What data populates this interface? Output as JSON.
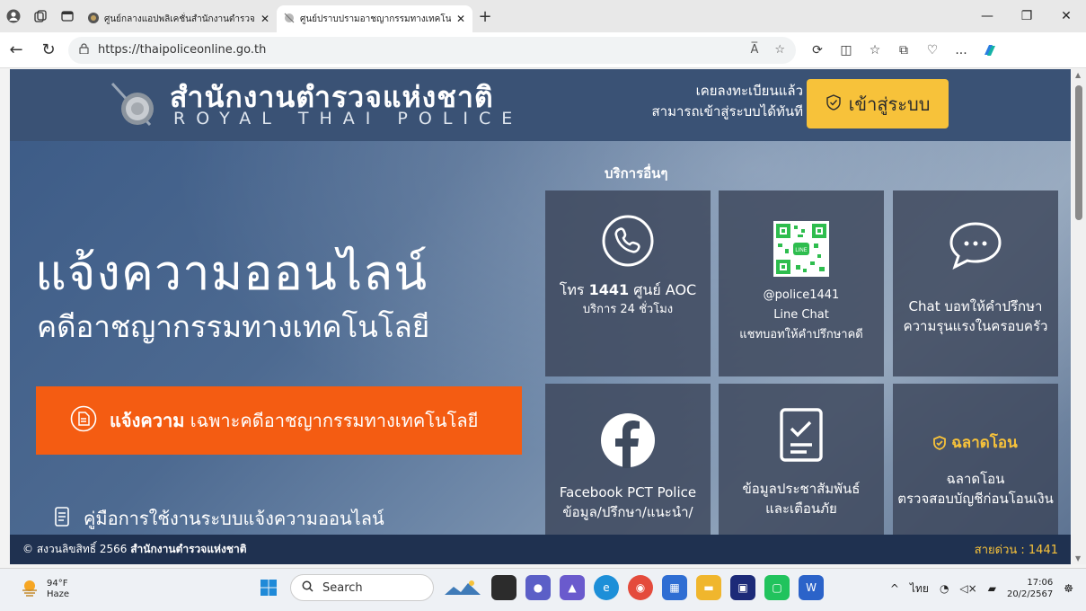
{
  "browser": {
    "tabs": [
      {
        "title": "ศูนย์กลางแอปพลิเคชั่นสำนักงานตำรวจ",
        "active": false
      },
      {
        "title": "ศูนย์ปราบปรามอาชญากรรมทางเทคโนโ",
        "active": true
      }
    ],
    "url": "https://thaipoliceonline.go.th",
    "reader_icon": "A̅",
    "more_label": "..."
  },
  "header": {
    "title_th": "สำนักงานตำรวจแห่งชาติ",
    "title_en": "ROYAL THAI POLICE",
    "registered_line1": "เคยลงทะเบียนแล้ว",
    "registered_line2": "สามารถเข้าสู่ระบบได้ทันที",
    "login_label": "เข้าสู่ระบบ"
  },
  "hero": {
    "title": "แจ้งความออนไลน์",
    "subtitle": "คดีอาชญากรรมทางเทคโนโลยี",
    "report_bold": "แจ้งความ",
    "report_rest": "เฉพาะคดีอาชญากรรมทางเทคโนโลยี",
    "manual": "คู่มือการใช้งานระบบแจ้งความออนไลน์"
  },
  "services": {
    "title": "บริการอื่นๆ",
    "cards": [
      {
        "l1_a": "โทร ",
        "l1_b": "1441",
        "l1_c": " ศูนย์ AOC",
        "l2": "บริการ 24 ชั่วโมง"
      },
      {
        "l1": "@police1441",
        "l2": "Line Chat",
        "l3": "แชทบอทให้คำปรึกษาคดี",
        "qr_label": "LINE"
      },
      {
        "l1": "Chat บอทให้คำปรึกษา",
        "l2": "ความรุนแรงในครอบครัว"
      },
      {
        "l1": "Facebook PCT Police",
        "l2": "ข้อมูล/ปรึกษา/แนะนำ/"
      },
      {
        "l1": "ข้อมูลประชาสัมพันธ์",
        "l2": "และเตือนภัย"
      },
      {
        "logo": "ฉลาดโอน",
        "l1": "ฉลาดโอน",
        "l2": "ตรวจสอบบัญชีก่อนโอนเงิน"
      }
    ]
  },
  "footer": {
    "copyright_a": "© สงวนลิขสิทธิ์ 2566 ",
    "copyright_b": "สำนักงานตำรวจแห่งชาติ",
    "hotline": "สายด่วน : 1441"
  },
  "taskbar": {
    "temp": "94°F",
    "condition": "Haze",
    "search": "Search",
    "lang": "ไทย",
    "time": "17:06",
    "date": "20/2/2567"
  },
  "colors": {
    "header_bg": "#3a5275",
    "login_yellow": "#f7c23a",
    "report_orange": "#f45c12",
    "footer_bg": "#1f3150"
  }
}
